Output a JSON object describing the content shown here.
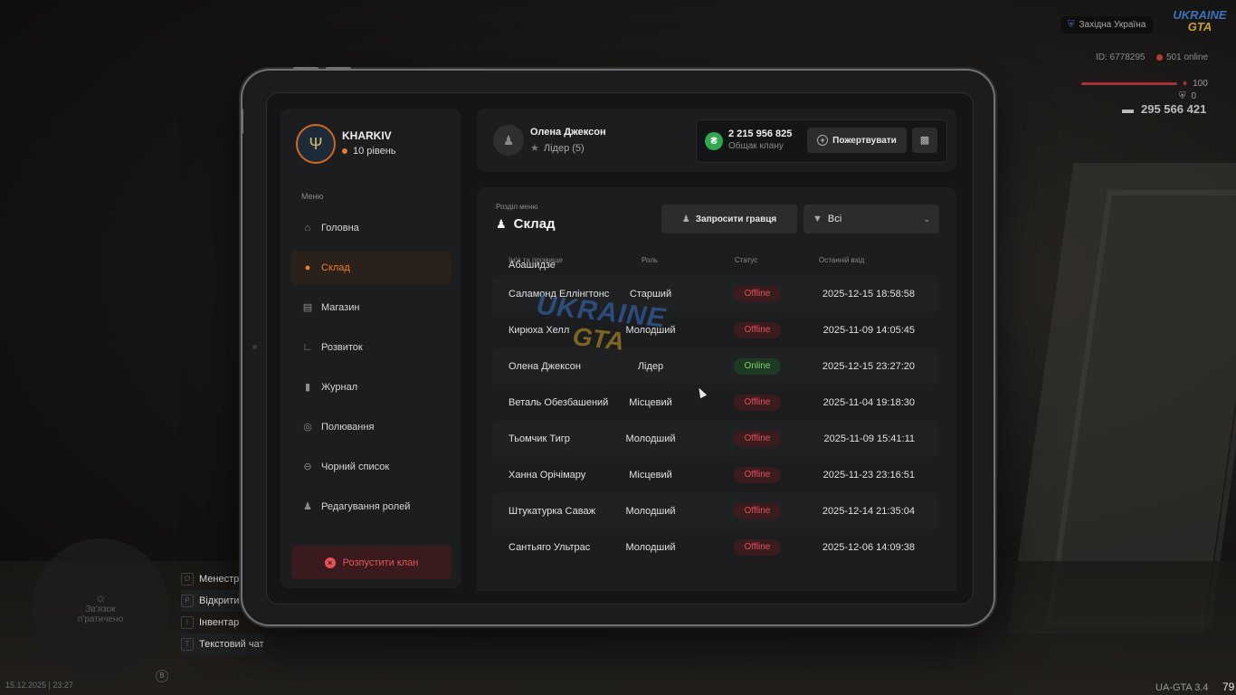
{
  "hud": {
    "region": "Західна Україна",
    "logo_top": "UKRAINE",
    "logo_bottom": "GTA",
    "player_id": "ID: 6778295",
    "online": "501 online",
    "health": "100",
    "armor": "0",
    "money": "295 566 421",
    "datetime": "15.12.2025 | 23:27",
    "version": "UA-GTA 3.4",
    "fps": "79",
    "minimap_text": "Зв'язок\nп'ратичено",
    "hints": [
      {
        "key": "O",
        "label": "Менестрі"
      },
      {
        "key": "P",
        "label": "Відкрити"
      },
      {
        "key": "I",
        "label": "Інвентар"
      },
      {
        "key": "T",
        "label": "Текстовий чат"
      }
    ],
    "mic_key": "B"
  },
  "clan": {
    "name": "KHARKIV",
    "level": "10 рівень"
  },
  "menu": {
    "title": "Меню",
    "items": [
      {
        "label": "Головна",
        "icon": "home-icon"
      },
      {
        "label": "Склад",
        "icon": "members-icon",
        "active": true
      },
      {
        "label": "Магазин",
        "icon": "basket-icon"
      },
      {
        "label": "Розвиток",
        "icon": "chart-icon"
      },
      {
        "label": "Журнал",
        "icon": "book-icon"
      },
      {
        "label": "Полювання",
        "icon": "target-icon"
      },
      {
        "label": "Чорний список",
        "icon": "block-icon"
      },
      {
        "label": "Редагування ролей",
        "icon": "user-edit-icon"
      }
    ],
    "disband": "Розпустити клан"
  },
  "user": {
    "name": "Олена Джексон",
    "role": "Лідер (5)"
  },
  "bank": {
    "amount": "2 215 956 825",
    "label": "Общак клану",
    "donate": "Пожертвувати"
  },
  "section": {
    "label": "Розділ меню",
    "title": "Склад",
    "invite": "Запросити гравця",
    "filter": "Всі"
  },
  "table": {
    "headers": [
      "Ім'я та прізвище",
      "Роль",
      "Статус",
      "Останній вхід"
    ],
    "top_partial": "Абашидзе",
    "rows": [
      {
        "name": "Саламонд Еллінгтонс",
        "role": "Старший",
        "status": "Offline",
        "last": "2025-12-15 18:58:58"
      },
      {
        "name": "Кирюха Хелл",
        "role": "Молодший",
        "status": "Offline",
        "last": "2025-11-09 14:05:45"
      },
      {
        "name": "Олена Джексон",
        "role": "Лідер",
        "status": "Online",
        "last": "2025-12-15 23:27:20"
      },
      {
        "name": "Веталь Обезбашений",
        "role": "Місцевий",
        "status": "Offline",
        "last": "2025-11-04 19:18:30"
      },
      {
        "name": "Тьомчик Тигр",
        "role": "Молодший",
        "status": "Offline",
        "last": "2025-11-09 15:41:11"
      },
      {
        "name": "Ханна Орічімару",
        "role": "Місцевий",
        "status": "Offline",
        "last": "2025-11-23 23:16:51"
      },
      {
        "name": "Штукатурка Саваж",
        "role": "Молодший",
        "status": "Offline",
        "last": "2025-12-14 21:35:04"
      },
      {
        "name": "Сантьяго Ультрас",
        "role": "Молодший",
        "status": "Offline",
        "last": "2025-12-06 14:09:38"
      }
    ]
  },
  "watermark": {
    "top": "UKRAINE",
    "bottom": "GTA"
  },
  "colors": {
    "accent": "#f07d2b",
    "offline": "#e05059",
    "online": "#7ad16f",
    "danger": "#e8535a"
  }
}
